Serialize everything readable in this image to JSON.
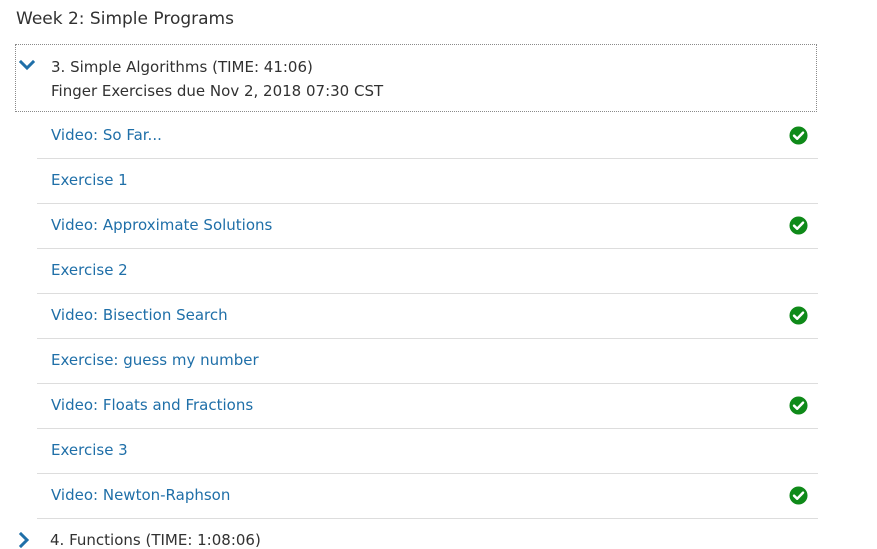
{
  "week": {
    "title": "Week 2: Simple Programs"
  },
  "section": {
    "title": "3. Simple Algorithms (TIME: 41:06)",
    "due": "Finger Exercises due Nov 2, 2018 07:30 CST",
    "expanded": true,
    "items": [
      {
        "label": "Video: So Far...",
        "completed": true
      },
      {
        "label": "Exercise 1",
        "completed": false
      },
      {
        "label": "Video: Approximate Solutions",
        "completed": true
      },
      {
        "label": "Exercise 2",
        "completed": false
      },
      {
        "label": "Video: Bisection Search",
        "completed": true
      },
      {
        "label": "Exercise: guess my number",
        "completed": false
      },
      {
        "label": "Video: Floats and Fractions",
        "completed": true
      },
      {
        "label": "Exercise 3",
        "completed": false
      },
      {
        "label": "Video: Newton-Raphson",
        "completed": true
      }
    ]
  },
  "next_section": {
    "title": "4. Functions (TIME: 1:08:06)",
    "expanded": false
  },
  "colors": {
    "link": "#1f6fa8",
    "text": "#313131",
    "check": "#0f8a19",
    "chevron": "#1f6fa8",
    "divider": "#dddddd"
  },
  "icons": {
    "expanded": "chevron-down-icon",
    "collapsed": "chevron-right-icon",
    "completed": "check-circle-icon"
  }
}
